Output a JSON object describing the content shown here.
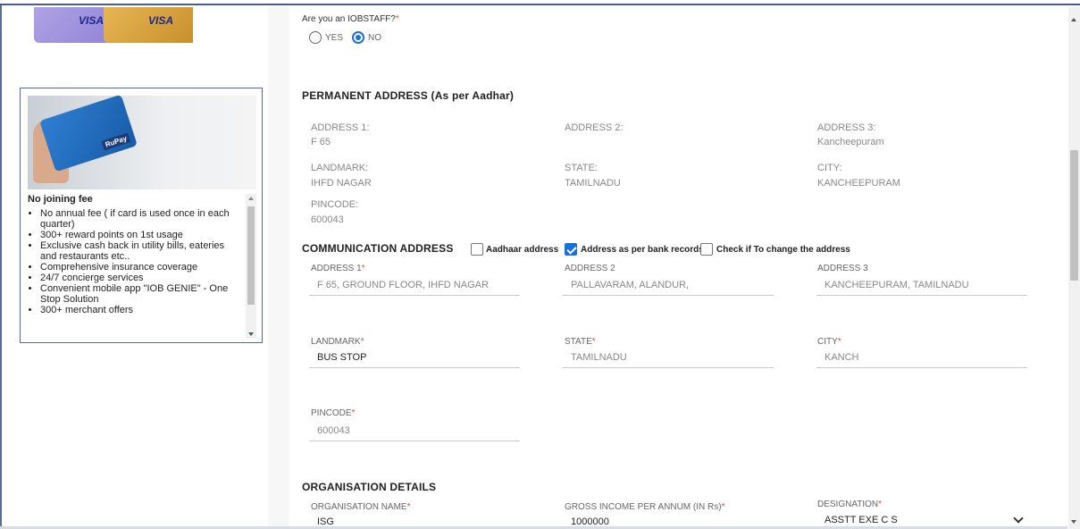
{
  "colors": {
    "accent": "#1a6fd8",
    "required": "#d9534f",
    "frame": "#4a5e86"
  },
  "left": {
    "top_card": {
      "visa_1": "VISA",
      "visa_2": "VISA"
    },
    "promo": {
      "rupay": "RuPay",
      "heading": "No joining fee",
      "items": [
        "No annual fee ( if card is used once in each quarter)",
        "300+ reward points on 1st usage",
        "Exclusive cash back in utility bills, eateries and restaurants etc..",
        "Comprehensive insurance coverage",
        "24/7 concierge services",
        "Convenient mobile app \"IOB GENIE\" - One Stop Solution",
        "300+ merchant offers"
      ]
    }
  },
  "form": {
    "iobstaff": {
      "question": "Are you an IOBSTAFF?",
      "req": "*",
      "yes": "YES",
      "no": "NO",
      "selected": "NO"
    },
    "permanent": {
      "title": "PERMANENT ADDRESS (As per Aadhar)",
      "address1_label": "ADDRESS 1:",
      "address1": "F 65",
      "address2_label": "ADDRESS 2:",
      "address2": "",
      "address3_label": "ADDRESS 3:",
      "address3": "Kancheepuram",
      "landmark_label": "LANDMARK:",
      "landmark": "IHFD NAGAR",
      "state_label": "STATE:",
      "state": "TAMILNADU",
      "city_label": "CITY:",
      "city": "KANCHEEPURAM",
      "pincode_label": "PINCODE:",
      "pincode": "600043"
    },
    "communication": {
      "title": "COMMUNICATION ADDRESS",
      "opt_aadhaar": "Aadhaar address",
      "opt_bank": "Address as per bank records",
      "opt_change": "Check if To change the address",
      "address1_label": "ADDRESS 1",
      "address1": "F 65, GROUND FLOOR, IHFD NAGAR",
      "address2_label": "ADDRESS 2",
      "address2": "PALLAVARAM, ALANDUR,",
      "address3_label": "ADDRESS 3",
      "address3": "KANCHEEPURAM, TAMILNADU",
      "landmark_label": "LANDMARK",
      "landmark": "BUS STOP",
      "state_label": "STATE",
      "state": "TAMILNADU",
      "city_label": "CITY",
      "city": "KANCH",
      "pincode_label": "PINCODE",
      "pincode": "600043",
      "req": "*"
    },
    "organisation": {
      "title": "ORGANISATION DETAILS",
      "name_label": "ORGANISATION NAME",
      "name": "ISG",
      "income_label": "GROSS INCOME PER ANNUM (IN Rs)",
      "income": "1000000",
      "designation_label": "DESIGNATION",
      "designation": "ASSTT EXE C S",
      "req": "*"
    }
  }
}
